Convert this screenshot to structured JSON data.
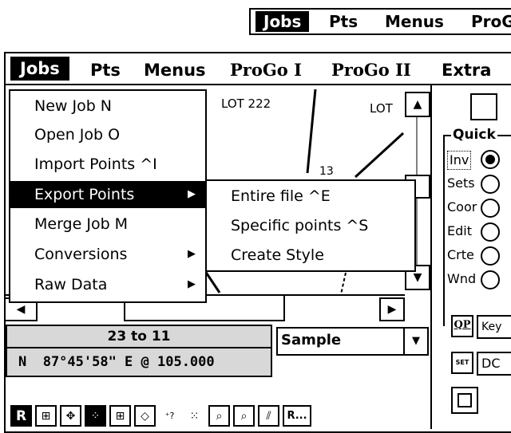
{
  "top_menubar": {
    "items": [
      "Jobs",
      "Pts",
      "Menus",
      "ProG"
    ]
  },
  "menubar": {
    "items": [
      "Jobs",
      "Pts",
      "Menus",
      "ProGo I",
      "ProGo II",
      "Extra"
    ]
  },
  "map": {
    "labels": [
      "LOT 222",
      "LOT",
      "13"
    ]
  },
  "jobs_menu": {
    "items": [
      {
        "label": "New Job N"
      },
      {
        "label": "Open Job O"
      },
      {
        "label": "Import Points ^I"
      },
      {
        "label": "Export Points",
        "submenu": true
      },
      {
        "label": "Merge Job M"
      },
      {
        "label": "Conversions",
        "submenu": true
      },
      {
        "label": "Raw Data",
        "submenu": true
      }
    ]
  },
  "export_submenu": {
    "items": [
      "Entire file ^E",
      "Specific points ^S",
      "Create Style"
    ]
  },
  "status": {
    "range": "23 to 11",
    "bearing": "N  87°45'58\" E @ 105.000",
    "style_select": "Sample"
  },
  "quick_panel": {
    "title": "Quick",
    "options": [
      "Inv",
      "Sets",
      "Coor",
      "Edit",
      "Crte",
      "Wnd"
    ],
    "selected": "Inv",
    "qp_button": "QP",
    "key_field": "Key",
    "set_button": "SET",
    "dc_field": "DC"
  },
  "toolbar": {
    "first": "R",
    "last": "R..."
  },
  "icons": [
    "arrow-up-icon",
    "arrow-down-icon",
    "arrow-left-icon",
    "arrow-right-icon",
    "chevron-right-icon",
    "dropdown-arrow-icon"
  ]
}
